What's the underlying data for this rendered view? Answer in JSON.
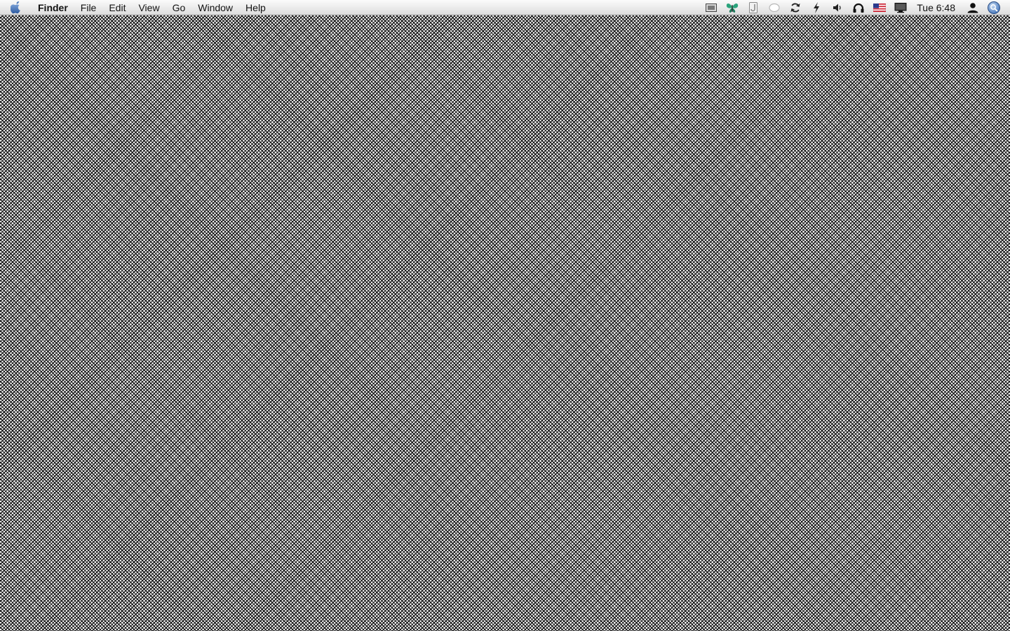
{
  "menubar": {
    "apple_icon": "apple-icon",
    "app_name": "Finder",
    "menus": [
      "File",
      "Edit",
      "View",
      "Go",
      "Window",
      "Help"
    ],
    "status_icons": [
      "screen-capture-icon",
      "butterfly-icon",
      "jump-desktop-icon",
      "bubble-icon",
      "sync-icon",
      "bolt-icon",
      "volume-icon",
      "headphones-icon",
      "us-flag-icon",
      "display-icon"
    ],
    "clock": "Tue 6:48",
    "user_icon": "user-icon",
    "spotlight_icon": "spotlight-icon"
  },
  "desktop": {
    "pattern": "black-white-crosshatch"
  },
  "colors": {
    "menubar_top": "#fbfbfb",
    "menubar_bottom": "#dcdcdc",
    "pattern_dark": "#1a1a1a",
    "pattern_light": "#ffffff",
    "butterfly": "#2aa37b",
    "flag_red": "#cc2233",
    "flag_blue": "#2a3a8c"
  }
}
